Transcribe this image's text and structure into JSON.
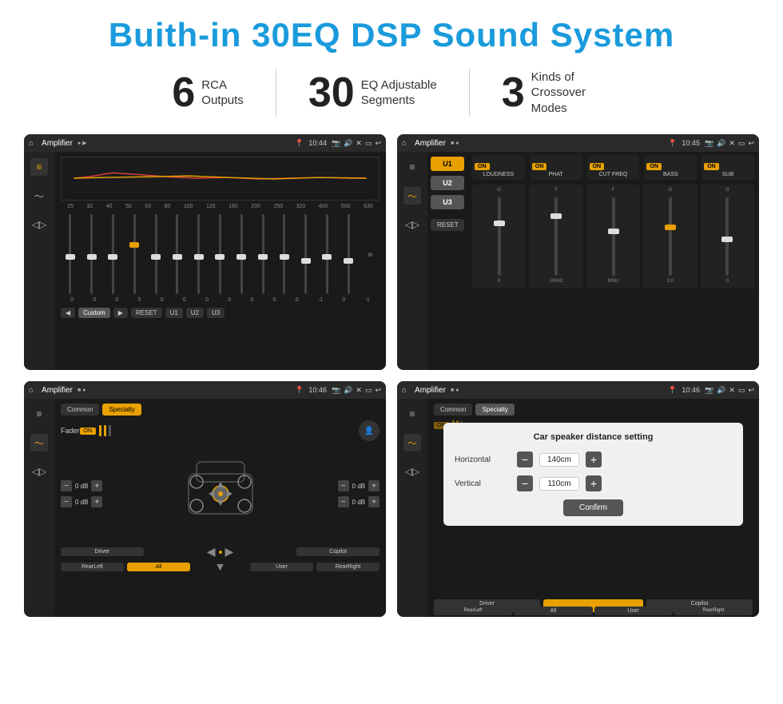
{
  "header": {
    "title": "Buith-in 30EQ DSP Sound System"
  },
  "stats": [
    {
      "number": "6",
      "label": "RCA\nOutputs"
    },
    {
      "number": "30",
      "label": "EQ Adjustable\nSegments"
    },
    {
      "number": "3",
      "label": "Kinds of\nCrossover Modes"
    }
  ],
  "screens": [
    {
      "id": "eq-screen",
      "topbar": {
        "title": "Amplifier",
        "time": "10:44"
      },
      "eq_freqs": [
        "25",
        "32",
        "40",
        "50",
        "63",
        "80",
        "100",
        "125",
        "160",
        "200",
        "250",
        "320",
        "400",
        "500",
        "630"
      ],
      "eq_values": [
        "0",
        "0",
        "0",
        "5",
        "0",
        "0",
        "0",
        "0",
        "0",
        "0",
        "0",
        "-1",
        "0",
        "-1"
      ],
      "buttons": [
        "Custom",
        "RESET",
        "U1",
        "U2",
        "U3"
      ]
    },
    {
      "id": "crossover-screen",
      "topbar": {
        "title": "Amplifier",
        "time": "10:45"
      },
      "u_buttons": [
        "U1",
        "U2",
        "U3"
      ],
      "modules": [
        "LOUDNESS",
        "PHAT",
        "CUT FREQ",
        "BASS",
        "SUB"
      ],
      "reset_label": "RESET"
    },
    {
      "id": "fader-screen",
      "topbar": {
        "title": "Amplifier",
        "time": "10:46"
      },
      "tabs": [
        "Common",
        "Specialty"
      ],
      "fader_label": "Fader",
      "db_values": [
        "0 dB",
        "0 dB",
        "0 dB",
        "0 dB"
      ],
      "bottom_btns": [
        "Driver",
        "",
        "Copilot",
        "RearLeft",
        "All",
        "User",
        "RearRight"
      ]
    },
    {
      "id": "distance-screen",
      "topbar": {
        "title": "Amplifier",
        "time": "10:46"
      },
      "tabs": [
        "Common",
        "Specialty"
      ],
      "dialog": {
        "title": "Car speaker distance setting",
        "horizontal_label": "Horizontal",
        "horizontal_value": "140cm",
        "vertical_label": "Vertical",
        "vertical_value": "110cm",
        "confirm_label": "Confirm"
      },
      "bottom_btns": [
        "Driver",
        "",
        "Copilot",
        "RearLeft",
        "All",
        "User",
        "RearRight"
      ]
    }
  ]
}
